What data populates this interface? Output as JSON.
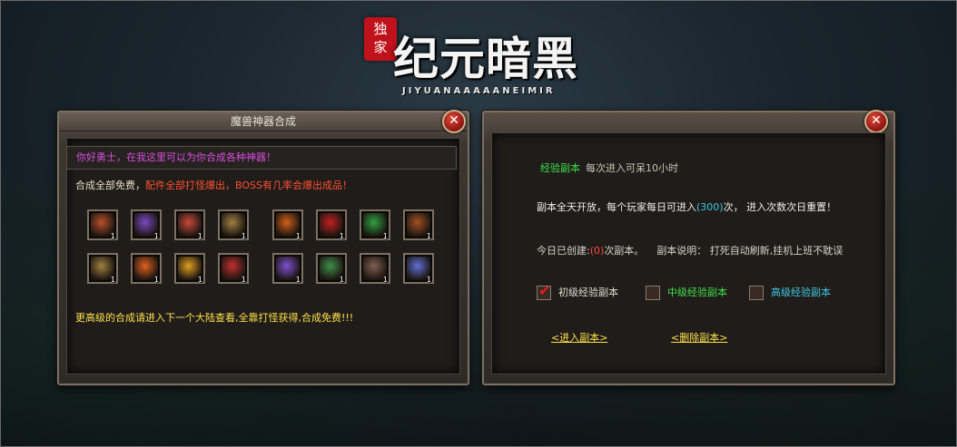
{
  "logo": {
    "seal_top": "独",
    "seal_bottom": "家",
    "title": "纪元暗黑",
    "subtitle": "JIYUANAAAAANEIMIR"
  },
  "left_panel": {
    "title": "魔兽神器合成",
    "close_label": "✕",
    "greeting": "你好勇士，在我这里可以为你合成各种神器！",
    "free_text": "合成全部免费，",
    "drop_text": "配件全部打怪爆出，BOSS有几率会爆出成品！",
    "footer_text": "更高级的合成请进入下一个大陆查看,全靠打怪获得,合成免费!!!",
    "items": [
      {
        "icon": "sword-icon",
        "count": "1",
        "color": "#b8502a"
      },
      {
        "icon": "purple-blade-icon",
        "count": "1",
        "color": "#7a4ac0"
      },
      {
        "icon": "dagger-icon",
        "count": "1",
        "color": "#c84a3a"
      },
      {
        "icon": "bow-icon",
        "count": "1",
        "color": "#a08040"
      },
      {
        "icon": "armor-icon",
        "count": "1",
        "color": "#d0601a"
      },
      {
        "icon": "ring-icon",
        "count": "1",
        "color": "#c02020"
      },
      {
        "icon": "green-orb-icon",
        "count": "1",
        "color": "#30a040"
      },
      {
        "icon": "gauntlet-icon",
        "count": "1",
        "color": "#a05020"
      },
      {
        "icon": "amulet-icon",
        "count": "1",
        "color": "#a08040"
      },
      {
        "icon": "flame-staff-icon",
        "count": "1",
        "color": "#e06020"
      },
      {
        "icon": "gold-chest-icon",
        "count": "1",
        "color": "#e0a020"
      },
      {
        "icon": "red-helm-icon",
        "count": "1",
        "color": "#c03030"
      },
      {
        "icon": "violet-crystal-icon",
        "count": "1",
        "color": "#8050d0"
      },
      {
        "icon": "green-rune-icon",
        "count": "1",
        "color": "#40904a"
      },
      {
        "icon": "dark-helm-icon",
        "count": "1",
        "color": "#806050"
      },
      {
        "icon": "spirit-icon",
        "count": "1",
        "color": "#6070d0"
      }
    ]
  },
  "right_panel": {
    "close_label": "✕",
    "dungeon_name": "经验副本",
    "dungeon_note": "每次进入可呆10小时",
    "rule_prefix": "副本全天开放，每个玩家每日可进入",
    "rule_count": "(300)",
    "rule_suffix": "次， 进入次数次日重置！",
    "created_prefix": "今日已创建:",
    "created_count": "(0)",
    "created_suffix": "次副本。",
    "desc": "副本说明： 打死自动刷新,挂机上班不耽误",
    "options": [
      {
        "label": "初级经验副本",
        "checked": true
      },
      {
        "label": "中级经验副本",
        "checked": false
      },
      {
        "label": "高级经验副本",
        "checked": false
      }
    ],
    "enter_link": "<进入副本>",
    "delete_link": "<删除副本>"
  }
}
